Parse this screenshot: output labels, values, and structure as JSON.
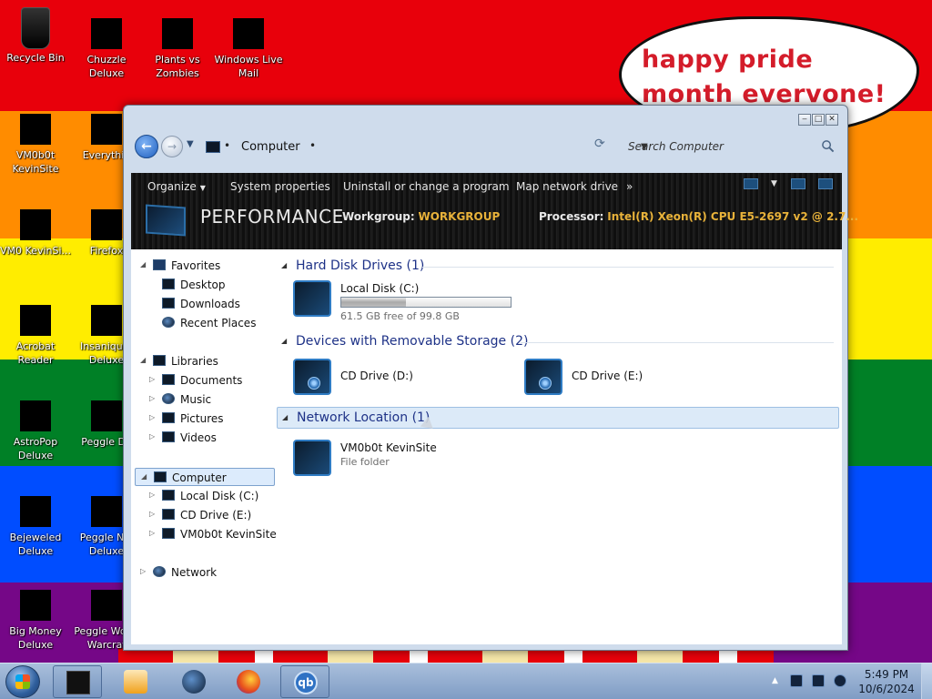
{
  "desktop": {
    "bubble_text": "happy pride month evervone!",
    "icons": [
      {
        "label": "Recycle Bin"
      },
      {
        "label": "Chuzzle Deluxe"
      },
      {
        "label": "Plants vs Zombies"
      },
      {
        "label": "Windows Live Mail"
      },
      {
        "label": "VM0b0t KevinSite"
      },
      {
        "label": "Everythin"
      },
      {
        "label": "VM0 KevinSi..."
      },
      {
        "label": "Firefox"
      },
      {
        "label": "Acrobat Reader"
      },
      {
        "label": "Insaniquar Deluxe"
      },
      {
        "label": "AstroPop Deluxe"
      },
      {
        "label": "Peggle De"
      },
      {
        "label": "Bejeweled Deluxe"
      },
      {
        "label": "Peggle Nig Deluxe"
      },
      {
        "label": "Big Money Deluxe"
      },
      {
        "label": "Peggle Wo of Warcraf"
      }
    ]
  },
  "window": {
    "address": {
      "location": "Computer",
      "search_placeholder": "Search Computer"
    },
    "commands": {
      "organize": "Organize",
      "system_properties": "System properties",
      "uninstall": "Uninstall or change a program",
      "map_drive": "Map network drive",
      "more": "»"
    },
    "banner": {
      "title": "PERFORMANCE",
      "workgroup_label": "Workgroup:",
      "workgroup_value": "WORKGROUP",
      "processor_label": "Processor:",
      "processor_value": "Intel(R) Xeon(R) CPU E5-2697 v2 @ 2.7..."
    },
    "nav": {
      "favorites": "Favorites",
      "desktop": "Desktop",
      "downloads": "Downloads",
      "recent": "Recent Places",
      "libraries": "Libraries",
      "documents": "Documents",
      "music": "Music",
      "pictures": "Pictures",
      "videos": "Videos",
      "computer": "Computer",
      "local_disk": "Local Disk (C:)",
      "cd_drive_e": "CD Drive (E:)",
      "vm_site": "VM0b0t KevinSite",
      "network": "Network"
    },
    "groups": {
      "hdd": {
        "title": "Hard Disk Drives (1)"
      },
      "removable": {
        "title": "Devices with Removable Storage (2)"
      },
      "network": {
        "title": "Network Location (1)"
      }
    },
    "drives": {
      "c": {
        "name": "Local Disk (C:)",
        "free_text": "61.5 GB free of 99.8 GB",
        "used_fraction": 0.384
      },
      "d": {
        "name": "CD Drive (D:)"
      },
      "e": {
        "name": "CD Drive (E:)"
      },
      "net": {
        "name": "VM0b0t KevinSite",
        "type": "File folder"
      }
    }
  },
  "taskbar": {
    "clock_time": "5:49 PM",
    "clock_date": "10/6/2024",
    "start_icon": "windows-orb-icon",
    "pinned": [
      "explorer-icon",
      "media-player-icon",
      "network-globe-icon",
      "firefox-icon",
      "qbittorrent-icon"
    ],
    "qb_label": "qb"
  }
}
